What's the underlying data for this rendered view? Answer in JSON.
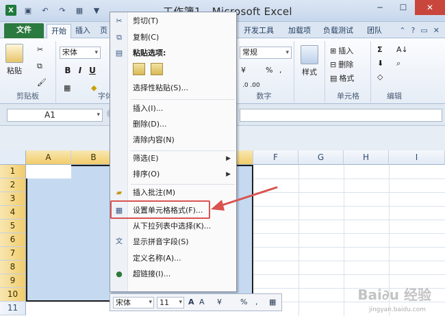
{
  "window": {
    "title": "工作簿1 - Microsoft Excel",
    "quick_access": [
      "save-icon",
      "undo-icon",
      "redo-icon",
      "table-icon",
      "filter-icon"
    ]
  },
  "tabs": {
    "file": "文件",
    "items": [
      "开始",
      "插入",
      "页",
      "",
      "",
      "",
      "开发工具",
      "加载项",
      "负载测试",
      "团队"
    ]
  },
  "ribbon": {
    "clipboard": {
      "paste": "粘贴",
      "label": "剪贴板"
    },
    "font": {
      "name": "宋体",
      "bold": "B",
      "italic": "I",
      "underline": "U",
      "label": "字体"
    },
    "number": {
      "format": "常规",
      "percent": "%",
      "comma": ",",
      "label": "数字"
    },
    "styles": {
      "label": "样式"
    },
    "cells": {
      "insert": "插入",
      "delete": "删除",
      "format": "格式",
      "label": "单元格"
    },
    "editing": {
      "sum": "Σ",
      "label": "编辑"
    }
  },
  "formula_bar": {
    "name_box": "A1"
  },
  "grid": {
    "columns": [
      "A",
      "B",
      "",
      "",
      "",
      "F",
      "G",
      "H",
      "I"
    ],
    "rows": [
      "1",
      "2",
      "3",
      "4",
      "5",
      "6",
      "7",
      "8",
      "9",
      "10",
      "11"
    ]
  },
  "context_menu": {
    "cut": "剪切(T)",
    "copy": "复制(C)",
    "paste_options": "粘贴选项:",
    "paste_special": "选择性粘贴(S)...",
    "insert": "插入(I)...",
    "delete": "删除(D)...",
    "clear": "清除内容(N)",
    "filter": "筛选(E)",
    "sort": "排序(O)",
    "insert_comment": "插入批注(M)",
    "format_cells": "设置单元格格式(F)...",
    "pick_list": "从下拉列表中选择(K)...",
    "phonetic": "显示拼音字段(S)",
    "define_name": "定义名称(A)...",
    "hyperlink": "超链接(I)..."
  },
  "mini_toolbar": {
    "font": "宋体",
    "size": "11",
    "grow": "A",
    "shrink": "A",
    "percent": "%",
    "comma": ","
  },
  "colors": {
    "file_tab": "#2b7a3f",
    "selection": "#c5daf1",
    "highlight": "#d9534f"
  }
}
